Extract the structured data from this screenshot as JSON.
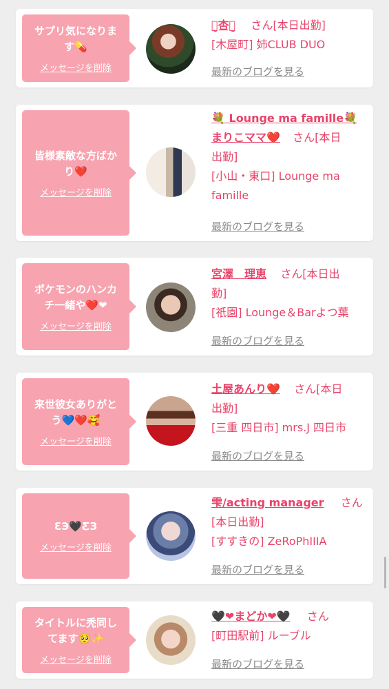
{
  "cards": [
    {
      "bubble": {
        "line1": "サプリ気になりま",
        "line2": "す💊",
        "delete": "メッセージを削除"
      },
      "name": "ꪔ̤̮杏ꪔ̤̮",
      "san": "さん",
      "status": "[本日出勤]",
      "shop": "[木屋町] 姉CLUB DUO",
      "blog": "最新のブログを見る"
    },
    {
      "bubble": {
        "line1": "皆様素敵な方ばか",
        "line2": "り❤️",
        "delete": "メッセージを削除"
      },
      "shop_title": "💐 Lounge ma famille💐",
      "name": "まりこママ❤️",
      "san": "さん[本日",
      "status": "出勤]",
      "shop": "[小山・東口] Lounge ma famille",
      "blog": "最新のブログを見る"
    },
    {
      "bubble": {
        "line1": "ポケモンのハンカ",
        "line2": "チ一緒や❤️❤",
        "delete": "メッセージを削除"
      },
      "name": "宮澤　理恵",
      "san": "さん[本日出",
      "status": "勤]",
      "shop": "[祇園] Lounge＆Barよつ葉",
      "blog": "最新のブログを見る"
    },
    {
      "bubble": {
        "line1": "来世彼女ありがと",
        "line2": "う💙❤️🥰",
        "delete": "メッセージを削除"
      },
      "name": "土屋あんり❤️",
      "san": "さん[本日",
      "status": "出勤]",
      "shop": "[三重 四日市] mrs.J 四日市",
      "blog": "最新のブログを見る"
    },
    {
      "bubble": {
        "line1": "ƐЭ🖤ƸЗ",
        "delete": "メッセージを削除"
      },
      "name": "雫/acting manager",
      "san": "さん",
      "status": "[本日出勤]",
      "shop": "[すすきの] ZeRoPhIIIA",
      "blog": "最新のブログを見る"
    },
    {
      "bubble": {
        "line1": "タイトルに秃同し",
        "line2": "てます🥺✨",
        "delete": "メッセージを削除"
      },
      "name": "🖤❤まどか❤🖤",
      "san": "さん",
      "shop": "[町田駅前] ルーブル",
      "blog": "最新のブログを見る"
    }
  ],
  "colors": {
    "accent": "#e8446a",
    "bubble": "#f7a3b0",
    "muted": "#8a8a8a"
  }
}
